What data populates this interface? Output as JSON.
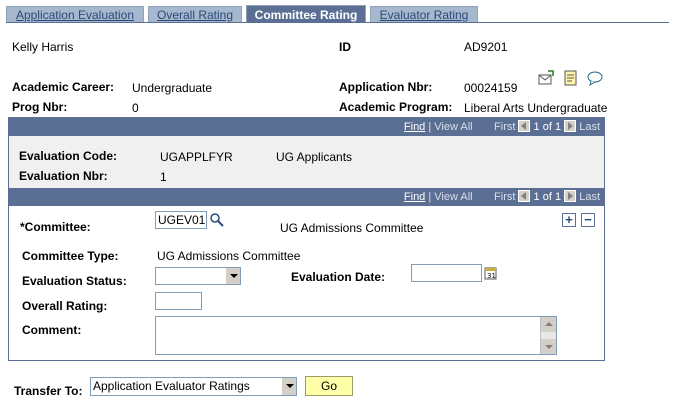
{
  "tabs": [
    {
      "label": "Application Evaluation",
      "active": false
    },
    {
      "label": "Overall Rating",
      "active": false
    },
    {
      "label": "Committee Rating",
      "active": true
    },
    {
      "label": "Evaluator Rating",
      "active": false
    }
  ],
  "header": {
    "name": "Kelly Harris",
    "id_label": "ID",
    "id_value": "AD9201",
    "career_label": "Academic Career:",
    "career_value": "Undergraduate",
    "app_nbr_label": "Application Nbr:",
    "app_nbr_value": "00024159",
    "prog_nbr_label": "Prog Nbr:",
    "prog_nbr_value": "0",
    "program_label": "Academic Program:",
    "program_value": "Liberal Arts Undergraduate"
  },
  "outer_nav": {
    "find": "Find",
    "view_all": "View All",
    "first": "First",
    "count": "1 of 1",
    "last": "Last"
  },
  "evaluation": {
    "code_label": "Evaluation Code:",
    "code_value": "UGAPPLFYR",
    "code_desc": "UG Applicants",
    "nbr_label": "Evaluation Nbr:",
    "nbr_value": "1"
  },
  "inner_nav": {
    "find": "Find",
    "view_all": "View All",
    "first": "First",
    "count": "1 of 1",
    "last": "Last"
  },
  "committee": {
    "committee_label": "*Committee:",
    "committee_value": "UGEV01",
    "committee_desc": "UG Admissions Committee",
    "type_label": "Committee Type:",
    "type_value": "UG Admissions Committee",
    "status_label": "Evaluation Status:",
    "status_value": "",
    "date_label": "Evaluation Date:",
    "date_value": "",
    "rating_label": "Overall Rating:",
    "rating_value": "",
    "comment_label": "Comment:",
    "comment_value": "",
    "add_row": "+",
    "delete_row": "−"
  },
  "footer": {
    "transfer_label": "Transfer To:",
    "transfer_value": "Application Evaluator Ratings",
    "go_label": "Go"
  },
  "colors": {
    "tab_inactive": "#a6b8cd",
    "tab_active": "#5a6f93",
    "nav_bar": "#5a6f93",
    "go_button": "#ffffa8"
  }
}
